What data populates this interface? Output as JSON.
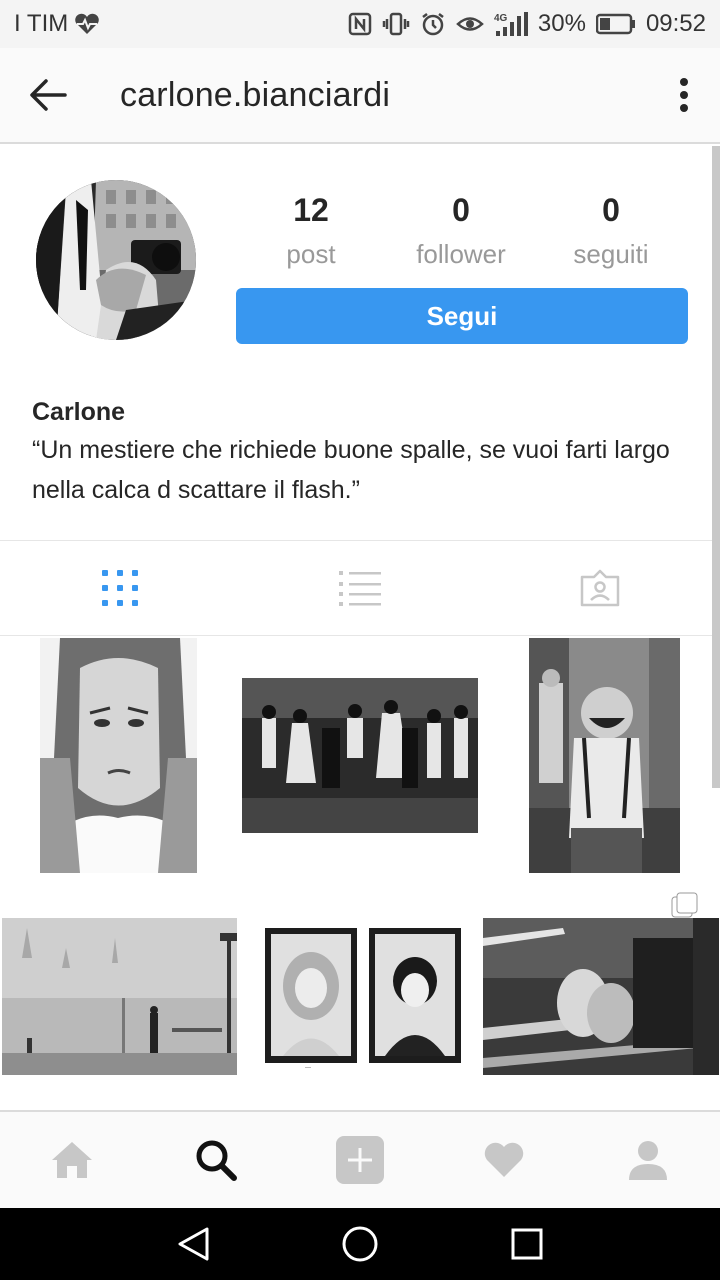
{
  "status_bar": {
    "carrier": "I TIM",
    "battery": "30%",
    "time": "09:52",
    "icons": [
      "heart-monitor-icon",
      "nfc-icon",
      "vibrate-icon",
      "alarm-icon",
      "eye-icon",
      "signal-4g-icon",
      "battery-icon"
    ]
  },
  "app_bar": {
    "username": "carlone.bianciardi",
    "back_icon": "arrow-left-icon",
    "more_icon": "more-vertical-icon"
  },
  "profile": {
    "stats": [
      {
        "value": "12",
        "label": "post"
      },
      {
        "value": "0",
        "label": "follower"
      },
      {
        "value": "0",
        "label": "seguiti"
      }
    ],
    "follow_label": "Segui",
    "name": "Carlone",
    "bio": "“Un mestiere che richiede buone spalle, se vuoi farti largo nella calca d scattare il flash.”"
  },
  "tabs": [
    {
      "icon": "grid-icon",
      "active": true
    },
    {
      "icon": "list-icon",
      "active": false
    },
    {
      "icon": "tagged-icon",
      "active": false
    }
  ],
  "bottom_nav": [
    {
      "icon": "home-icon"
    },
    {
      "icon": "search-icon",
      "active": true
    },
    {
      "icon": "add-post-icon"
    },
    {
      "icon": "heart-icon"
    },
    {
      "icon": "profile-icon"
    }
  ],
  "system_nav": [
    "back-triangle-icon",
    "home-circle-icon",
    "recents-square-icon"
  ],
  "colors": {
    "accent": "#3897f0",
    "status_bar": "#f4f4f4",
    "app_bar": "#fafafa",
    "divider": "#dbdbdb",
    "inactive_icon": "#c7c7c7"
  }
}
